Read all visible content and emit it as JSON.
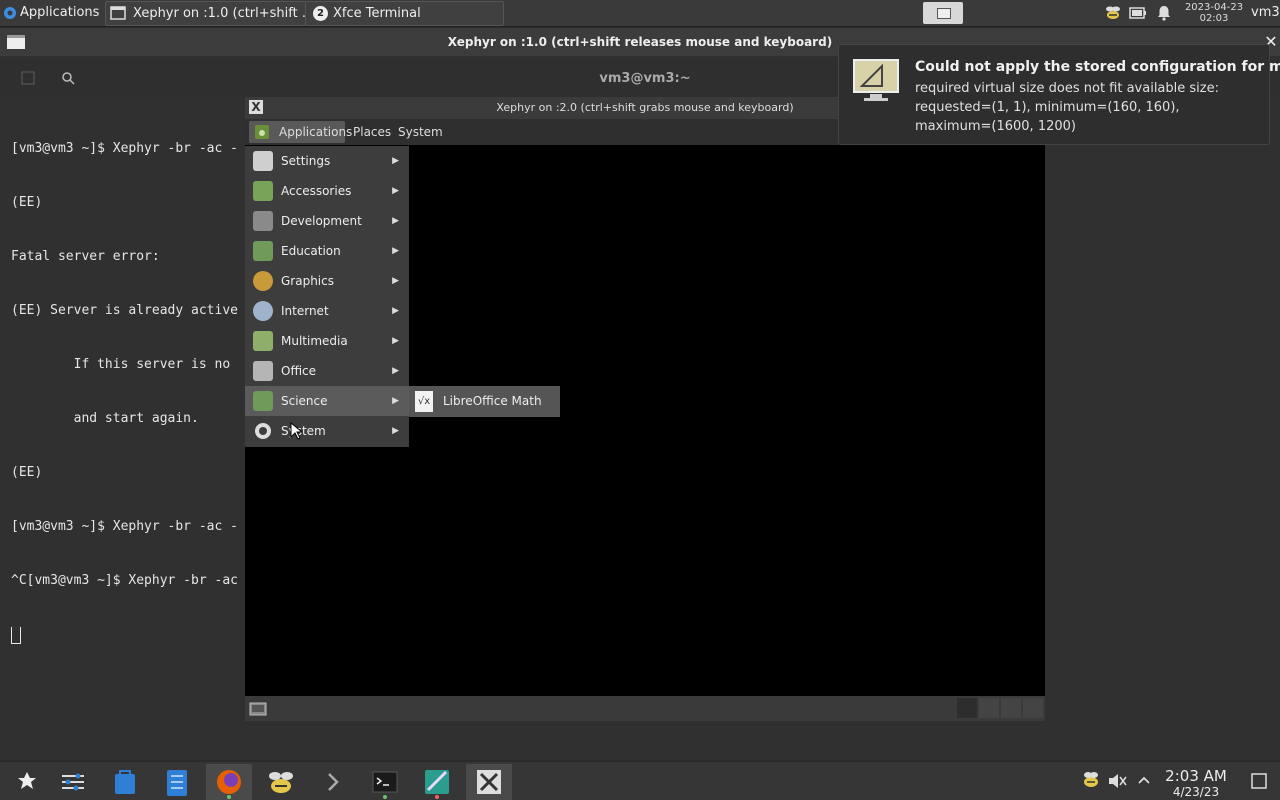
{
  "top_panel": {
    "applications_label": "Applications",
    "tasks": [
      {
        "label": "Xephyr on :1.0 (ctrl+shift ..."
      },
      {
        "label": "Xfce Terminal",
        "badge": "2"
      }
    ],
    "clock_date": "2023-04-23",
    "clock_time": "02:03",
    "user": "vm3"
  },
  "outer_window": {
    "title": "Xephyr on :1.0 (ctrl+shift releases mouse and keyboard)"
  },
  "terminal": {
    "title": "vm3@vm3:~",
    "lines": [
      "[vm3@vm3 ~]$ Xephyr -br -ac -",
      "(EE)",
      "Fatal server error:",
      "(EE) Server is already active",
      "        If this server is no",
      "        and start again.",
      "(EE)",
      "[vm3@vm3 ~]$ Xephyr -br -ac -",
      "^C[vm3@vm3 ~]$ Xephyr -br -ac"
    ]
  },
  "inner_window": {
    "title": "Xephyr on :2.0 (ctrl+shift grabs mouse and keyboard)",
    "menubar": {
      "applications": "Applications",
      "places": "Places",
      "system": "System"
    }
  },
  "app_menu": {
    "items": [
      {
        "label": "Settings",
        "icon": "settings-icon"
      },
      {
        "label": "Accessories",
        "icon": "accessories-icon"
      },
      {
        "label": "Development",
        "icon": "development-icon"
      },
      {
        "label": "Education",
        "icon": "education-icon"
      },
      {
        "label": "Graphics",
        "icon": "graphics-icon"
      },
      {
        "label": "Internet",
        "icon": "internet-icon"
      },
      {
        "label": "Multimedia",
        "icon": "multimedia-icon"
      },
      {
        "label": "Office",
        "icon": "office-icon"
      },
      {
        "label": "Science",
        "icon": "science-icon"
      },
      {
        "label": "System",
        "icon": "system-gear-icon"
      }
    ],
    "highlighted": "Science",
    "submenu": {
      "items": [
        {
          "label": "LibreOffice Math",
          "icon": "libreoffice-math-icon"
        }
      ]
    }
  },
  "notification": {
    "title": "Could not apply the stored configuration for mon...",
    "body_lines": [
      "required virtual size does not fit available size:",
      "requested=(1, 1), minimum=(160, 160),",
      "maximum=(1600, 1200)"
    ]
  },
  "taskbar": {
    "time": "2:03 AM",
    "date": "4/23/23"
  },
  "colors": {
    "panel_bg": "#3a3a3a",
    "menu_bg": "#3d3d3d",
    "menu_highlight": "#5b5b5b",
    "firefox_orange": "#e66000",
    "accent_blue": "#2f7fd6"
  }
}
